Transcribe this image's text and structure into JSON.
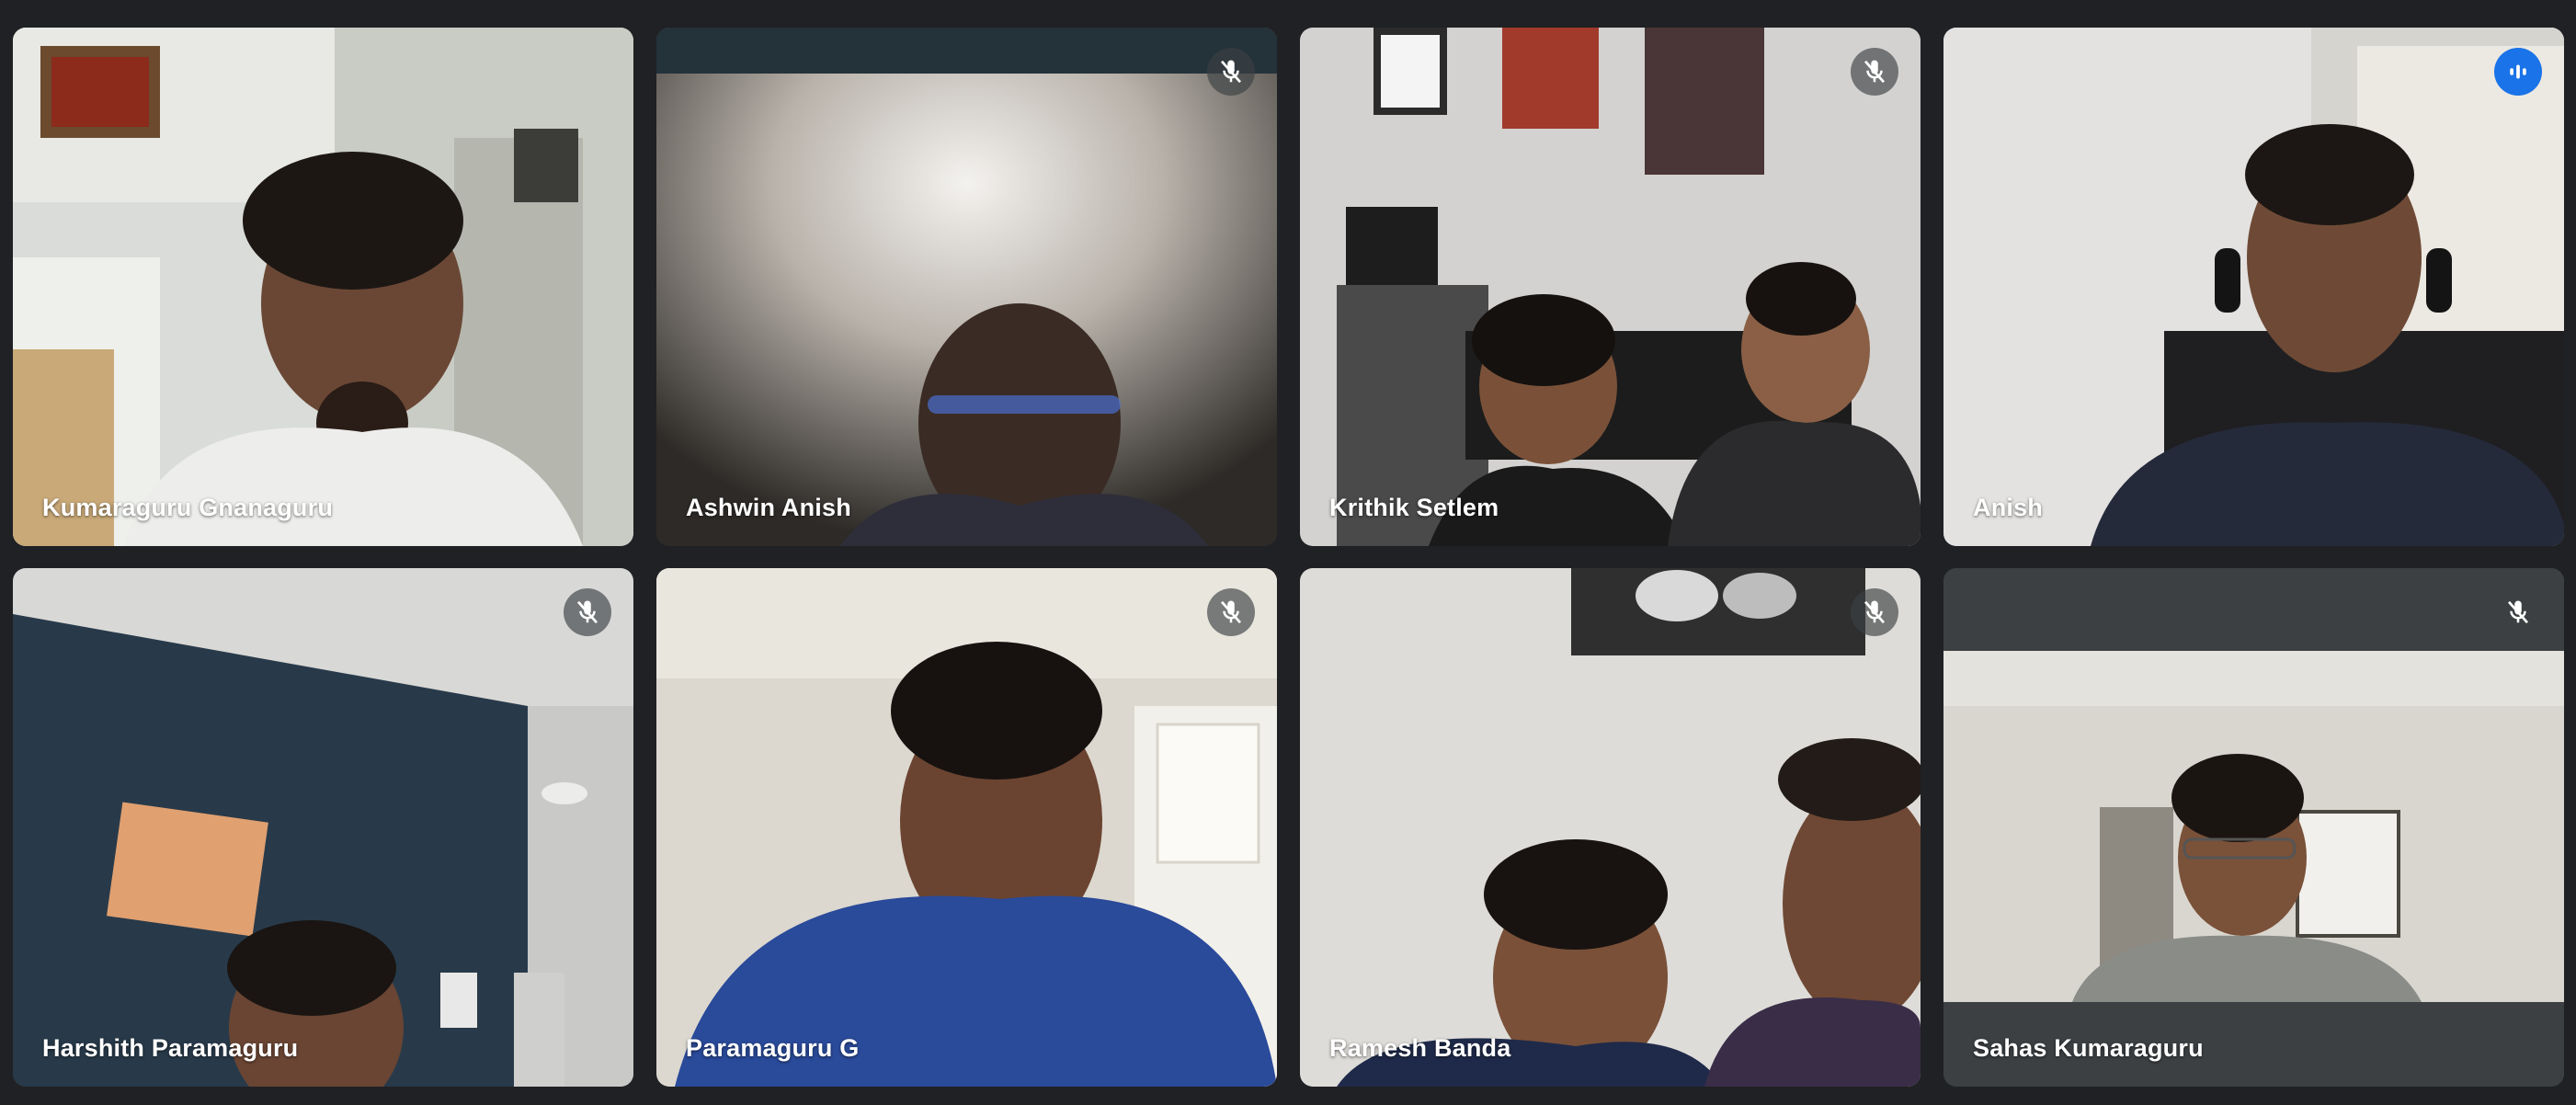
{
  "participants": [
    {
      "name": "Kumaraguru Gnanaguru",
      "mic": "none"
    },
    {
      "name": "Ashwin Anish",
      "mic": "muted"
    },
    {
      "name": "Krithik Setlem",
      "mic": "muted"
    },
    {
      "name": "Anish",
      "mic": "speaking"
    },
    {
      "name": "Harshith Paramaguru",
      "mic": "muted"
    },
    {
      "name": "Paramaguru G",
      "mic": "muted"
    },
    {
      "name": "Ramesh Banda",
      "mic": "muted"
    },
    {
      "name": "Sahas Kumaraguru",
      "mic": "muted"
    }
  ],
  "colors": {
    "background": "#202124",
    "active_border": "#8ab4f8",
    "speaking_badge": "#1a73e8",
    "muted_badge": "#3c4043"
  },
  "icons": {
    "muted": "mic-off-icon",
    "speaking": "audio-level-icon"
  }
}
